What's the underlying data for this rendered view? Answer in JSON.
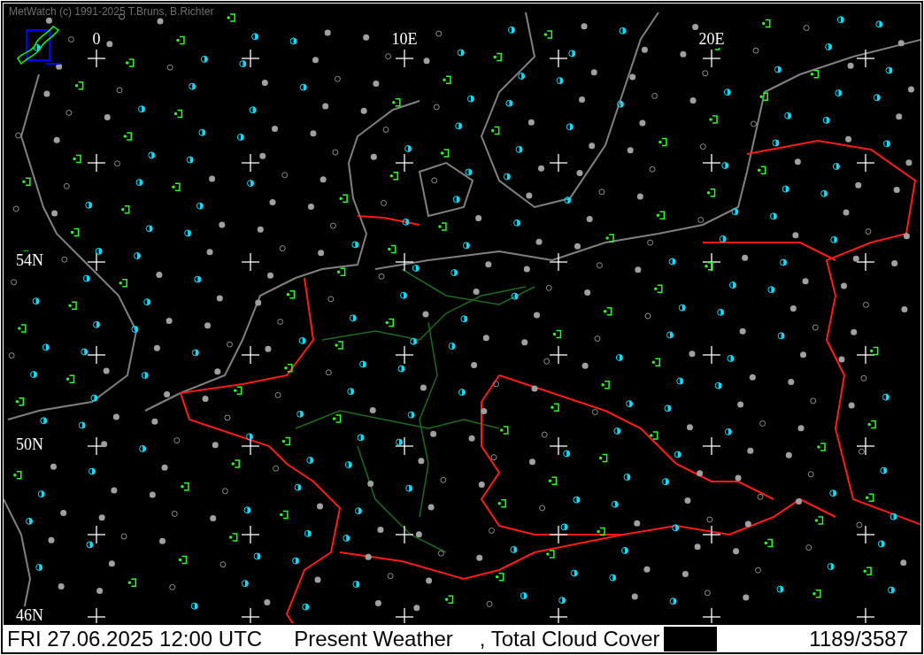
{
  "window": {
    "title": "MetWatch  (c) 1991-2025 T.Bruns, B.Richter"
  },
  "map": {
    "lon_labels": [
      "0",
      "10E",
      "20E"
    ],
    "lat_labels": [
      "54N",
      "50N",
      "46N"
    ]
  },
  "status_bar": {
    "datetime": "FRI 27.06.2025 12:00 UTC",
    "parameter_1": "Present Weather",
    "parameter_2": ", Total Cloud Cover",
    "count": "1189/3587"
  }
}
